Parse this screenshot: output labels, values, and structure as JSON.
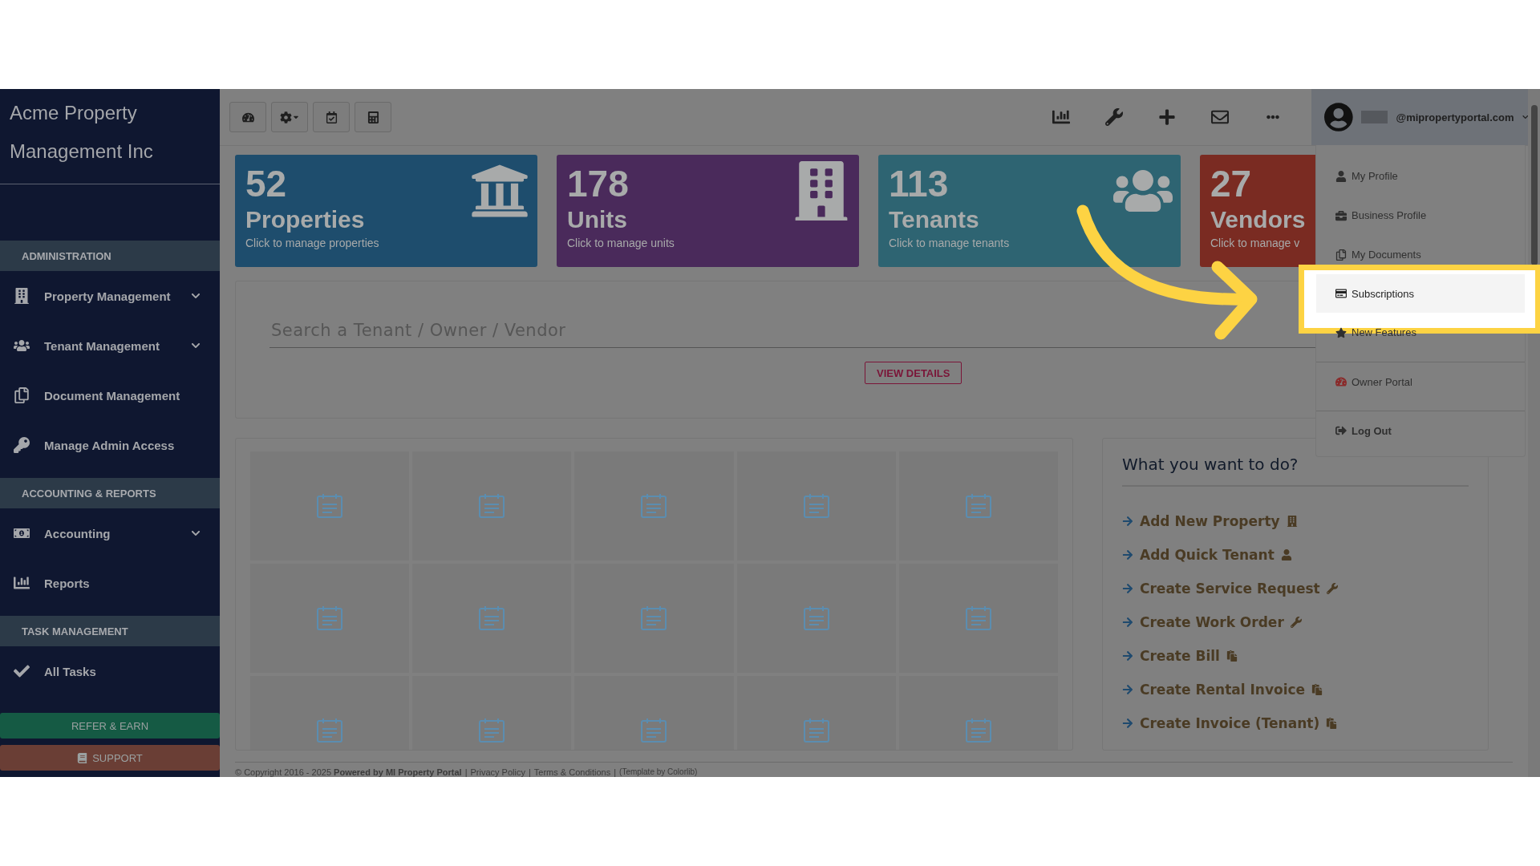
{
  "sidebar": {
    "title_lines": [
      "Acme Property",
      "Management Inc"
    ],
    "sections": [
      {
        "title": "ADMINISTRATION",
        "items": [
          {
            "label": "Property Management",
            "expandable": true
          },
          {
            "label": "Tenant Management",
            "expandable": true
          },
          {
            "label": "Document Management",
            "expandable": false
          },
          {
            "label": "Manage Admin Access",
            "expandable": false
          }
        ]
      },
      {
        "title": "ACCOUNTING & REPORTS",
        "items": [
          {
            "label": "Accounting",
            "expandable": true
          },
          {
            "label": "Reports",
            "expandable": false
          }
        ]
      },
      {
        "title": "TASK MANAGEMENT",
        "items": [
          {
            "label": "All Tasks",
            "expandable": false
          }
        ]
      }
    ],
    "buttons": [
      {
        "label": "REFER & EARN",
        "kind": "refer"
      },
      {
        "label": "SUPPORT",
        "kind": "support"
      }
    ]
  },
  "user_menu": {
    "email": "@mipropertyportal.com",
    "items": [
      {
        "label": "My Profile",
        "selected": false,
        "bold": false,
        "divider_before": false
      },
      {
        "label": "Business Profile",
        "selected": false,
        "bold": false,
        "divider_before": false
      },
      {
        "label": "My Documents",
        "selected": false,
        "bold": false,
        "divider_before": false
      },
      {
        "label": "Subscriptions",
        "selected": true,
        "bold": false,
        "divider_before": false
      },
      {
        "label": "New Features",
        "selected": false,
        "bold": false,
        "divider_before": false
      },
      {
        "label": "Owner Portal",
        "selected": false,
        "bold": false,
        "divider_before": true
      },
      {
        "label": "Log Out",
        "selected": false,
        "bold": true,
        "divider_before": true
      }
    ]
  },
  "cards": [
    {
      "number": "52",
      "label": "Properties",
      "caption": "Click to manage properties",
      "color": "#1e4d6d"
    },
    {
      "number": "178",
      "label": "Units",
      "caption": "Click to manage units",
      "color": "#4a2a5b"
    },
    {
      "number": "113",
      "label": "Tenants",
      "caption": "Click to manage tenants",
      "color": "#2e6472"
    },
    {
      "number": "27",
      "label": "Vendors",
      "caption": "Click to manage v",
      "color": "#7a2b22"
    }
  ],
  "search": {
    "placeholder": "Search a Tenant / Owner / Vendor",
    "button": "VIEW DETAILS"
  },
  "quick_actions": {
    "title": "What you want to do?",
    "items": [
      "Add New Property",
      "Add Quick Tenant",
      "Create Service Request",
      "Create Work Order",
      "Create Bill",
      "Create Rental Invoice",
      "Create Invoice (Tenant)"
    ]
  },
  "footer": {
    "separator": "|",
    "text": "© Copyright 2016 - 2025 **Powered by MI Property Portal**",
    "links": [
      "Privacy Policy",
      "Terms & Conditions"
    ],
    "credit": "(Template by Colorlib)"
  }
}
